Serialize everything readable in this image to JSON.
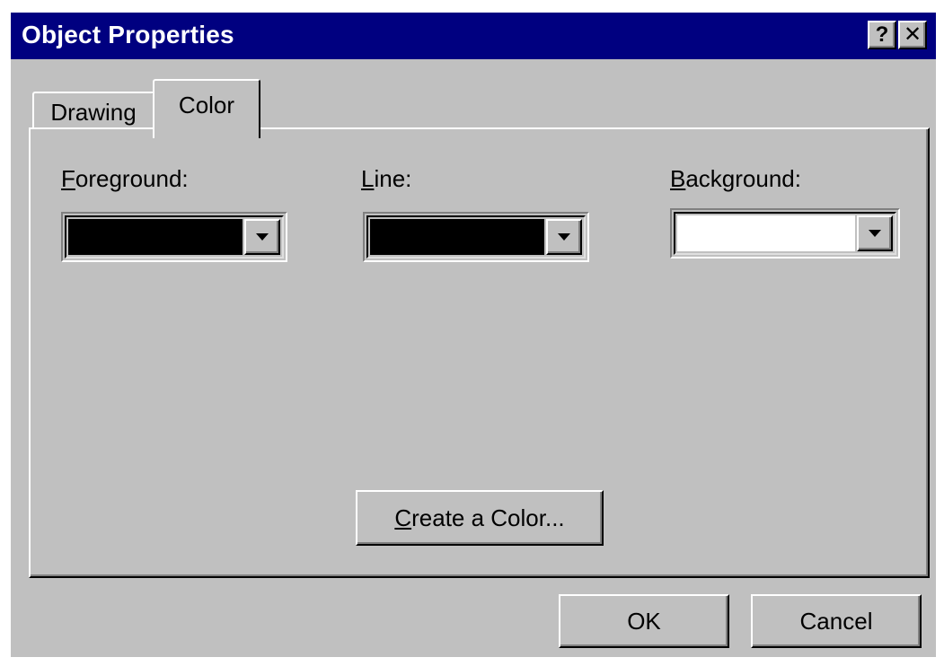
{
  "window": {
    "title": "Object Properties",
    "help_label": "?",
    "close_label": "✕"
  },
  "tabs": [
    {
      "label": "Drawing",
      "active": false
    },
    {
      "label": "Color",
      "active": true
    }
  ],
  "fields": {
    "foreground": {
      "label_accel": "F",
      "label_rest": "oreground:",
      "color": "#000000"
    },
    "line": {
      "label_accel": "L",
      "label_rest": "ine:",
      "color": "#000000"
    },
    "background": {
      "label_accel": "B",
      "label_rest": "ackground:",
      "color": "#ffffff"
    }
  },
  "buttons": {
    "create_accel": "C",
    "create_rest": "reate a Color...",
    "ok": "OK",
    "cancel": "Cancel"
  },
  "colors": {
    "titlebar": "#000080",
    "face": "#c0c0c0"
  }
}
